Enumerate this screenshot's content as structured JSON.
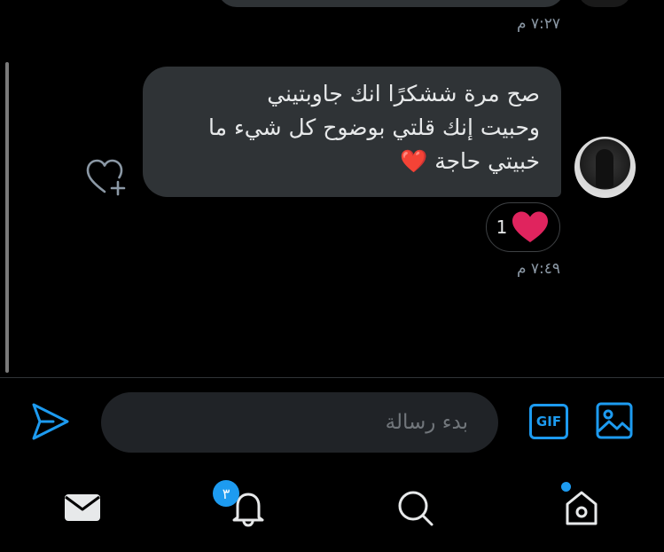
{
  "previous_message": {
    "timestamp": "٧:٢٧ م"
  },
  "message": {
    "lines": [
      "صح مرة ششكرًا انك جاوبتيني",
      "وحبيت إنك قلتي بوضوح كل شيء ما",
      "خبيتي حاجة ❤️"
    ],
    "timestamp": "٧:٤٩ م",
    "reaction": {
      "emoji_icon": "heart-icon",
      "count": "1",
      "color": "#e0245e"
    }
  },
  "composer": {
    "placeholder": "بدء رسالة",
    "gif_label": "GIF"
  },
  "bottom_nav": {
    "items": [
      "mail-icon",
      "bell-icon",
      "search-icon",
      "home-icon"
    ],
    "notifications_badge": "٣"
  },
  "colors": {
    "accent": "#1d9bf0",
    "bubble": "#2f3336",
    "background": "#000000"
  }
}
